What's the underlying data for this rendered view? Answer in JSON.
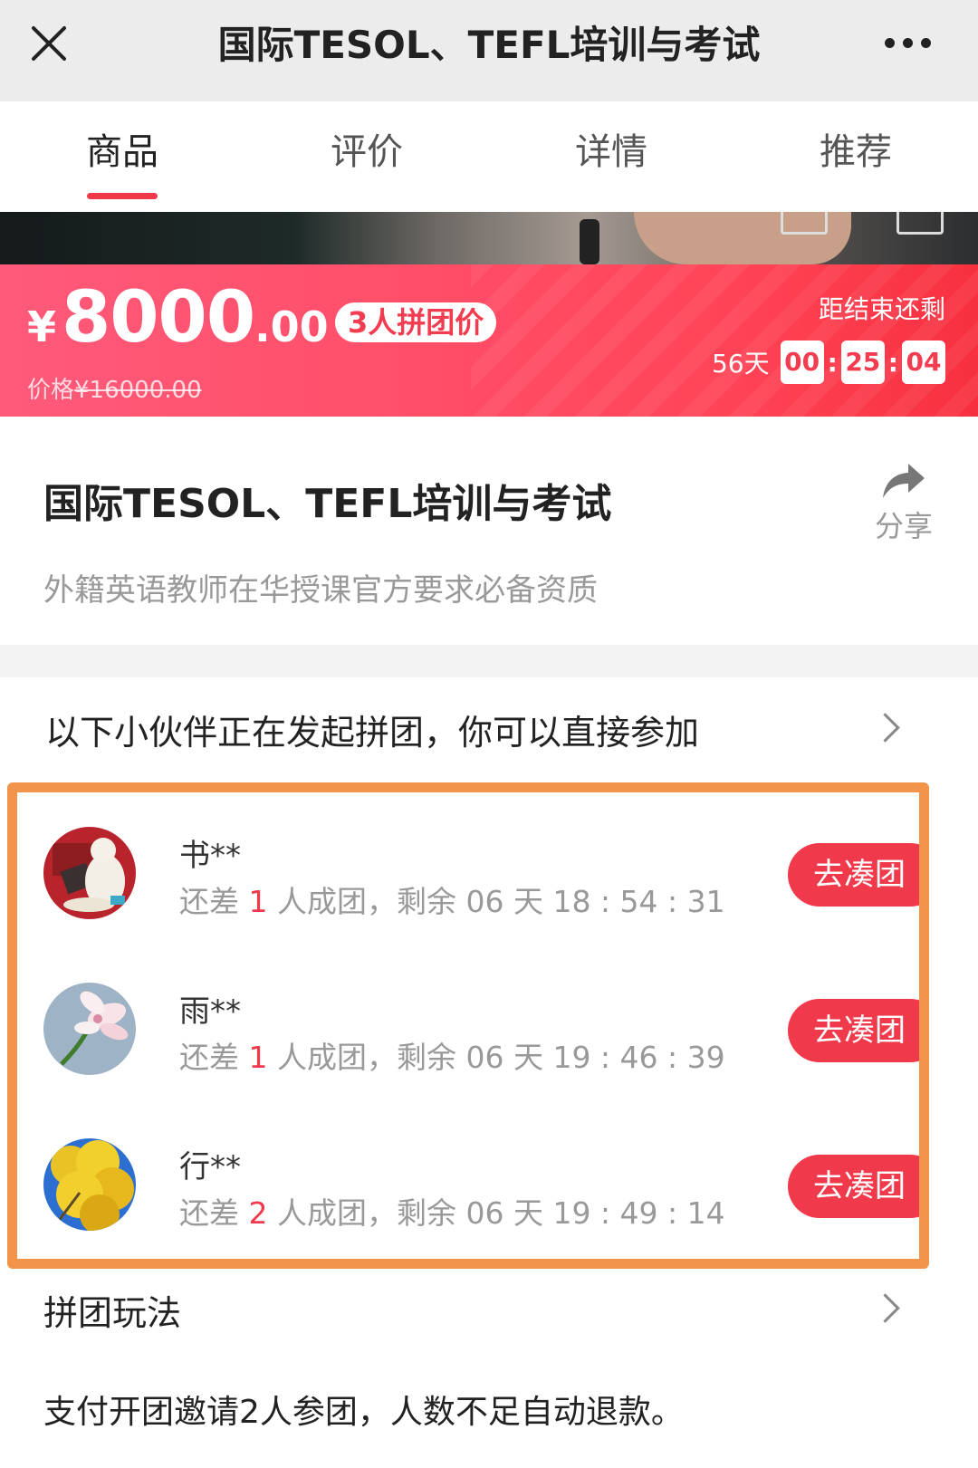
{
  "topbar": {
    "title": "国际TESOL、TEFL培训与考试"
  },
  "tabs": [
    {
      "label": "商品"
    },
    {
      "label": "评价"
    },
    {
      "label": "详情"
    },
    {
      "label": "推荐"
    }
  ],
  "price": {
    "currency": "¥",
    "integer": "8000",
    "decimal": ".00",
    "badge": "3人拼团价",
    "original_label": "价格",
    "original_value": "¥16000.00",
    "countdown_label": "距结束还剩",
    "countdown_days": "56天",
    "countdown_h": "00",
    "countdown_m": "25",
    "countdown_s": "04",
    "sep": ":"
  },
  "product": {
    "title": "国际TESOL、TEFL培训与考试",
    "subtitle": "外籍英语教师在华授课官方要求必备资质",
    "share_label": "分享"
  },
  "groups": {
    "header": "以下小伙伴正在发起拼团，你可以直接参加",
    "items": [
      {
        "name": "书**",
        "prefix": "还差 ",
        "need": "1",
        "suffix": " 人成团，剩余 06 天 18 : 54 : 31",
        "button": "去凑团"
      },
      {
        "name": "雨**",
        "prefix": "还差 ",
        "need": "1",
        "suffix": " 人成团，剩余 06 天 19 : 46 : 39",
        "button": "去凑团"
      },
      {
        "name": "行**",
        "prefix": "还差 ",
        "need": "2",
        "suffix": " 人成团，剩余 06 天 19 : 49 : 14",
        "button": "去凑团"
      }
    ]
  },
  "rules": {
    "title": "拼团玩法",
    "text": "支付开团邀请2人参团，人数不足自动退款。"
  },
  "colors": {
    "accent": "#f03a4c",
    "highlight": "#f2944a",
    "banner": "#ff4f6a"
  }
}
